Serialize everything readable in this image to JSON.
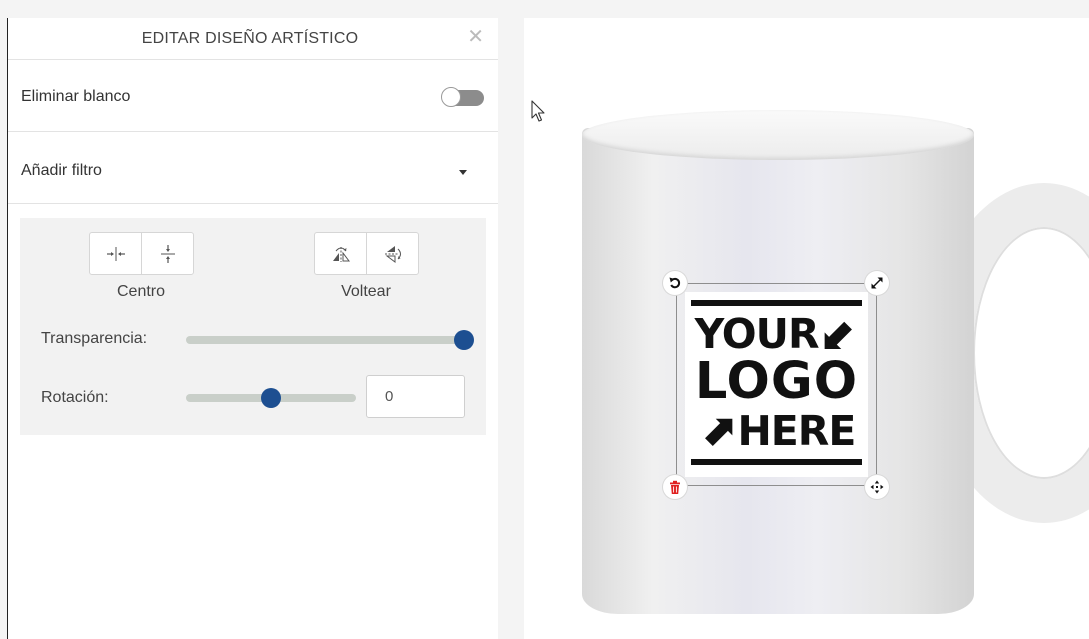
{
  "panel": {
    "title": "EDITAR DISEÑO ARTÍSTICO",
    "close_icon": "close-icon",
    "remove_white": {
      "label": "Eliminar blanco",
      "enabled": false
    },
    "add_filter": {
      "label": "Añadir filtro"
    }
  },
  "tools": {
    "center": {
      "label": "Centro",
      "buttons": [
        "center-horizontal-icon",
        "center-vertical-icon"
      ]
    },
    "flip": {
      "label": "Voltear",
      "buttons": [
        "flip-horizontal-icon",
        "flip-vertical-icon"
      ]
    },
    "transparency": {
      "label": "Transparencia:",
      "value": 1.0
    },
    "rotation": {
      "label": "Rotación:",
      "slider_value": 0.5,
      "input_value": "0"
    },
    "accent_color": "#1d4f91"
  },
  "canvas": {
    "logo": {
      "line1": "YOUR",
      "line2": "LOGO",
      "line3": "HERE"
    },
    "handles": [
      "rotate-icon",
      "resize-icon",
      "delete-icon",
      "move-icon"
    ],
    "delete_color": "#e02020"
  }
}
